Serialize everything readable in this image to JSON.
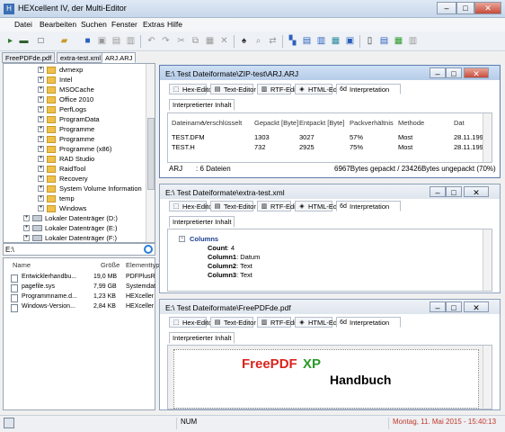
{
  "app": {
    "title": "HEXcellent IV, der Multi-Editor",
    "minimize": "–",
    "maximize": "□",
    "close": "✕"
  },
  "menu": [
    "Datei",
    "Bearbeiten",
    "Suchen",
    "Fenster",
    "Extras",
    "Hilfe"
  ],
  "file_tabs": [
    "FreePDFde.pdf",
    "extra-test.xml",
    "ARJ.ARJ"
  ],
  "tree": [
    {
      "label": "dvmexp",
      "kind": "folder"
    },
    {
      "label": "Intel",
      "kind": "folder"
    },
    {
      "label": "MSOCache",
      "kind": "folder"
    },
    {
      "label": "Office 2010",
      "kind": "folder"
    },
    {
      "label": "PerfLogs",
      "kind": "folder"
    },
    {
      "label": "ProgramData",
      "kind": "folder"
    },
    {
      "label": "Programme",
      "kind": "folder"
    },
    {
      "label": "Programme",
      "kind": "folder"
    },
    {
      "label": "Programme (x86)",
      "kind": "folder"
    },
    {
      "label": "RAD Studio",
      "kind": "folder"
    },
    {
      "label": "RaidTool",
      "kind": "folder"
    },
    {
      "label": "Recovery",
      "kind": "folder"
    },
    {
      "label": "System Volume Information",
      "kind": "folder"
    },
    {
      "label": "temp",
      "kind": "folder"
    },
    {
      "label": "Windows",
      "kind": "folder"
    },
    {
      "label": "Lokaler Datenträger (D:)",
      "kind": "drive"
    },
    {
      "label": "Lokaler Datenträger (E:)",
      "kind": "drive"
    },
    {
      "label": "Lokaler Datenträger (F:)",
      "kind": "drive"
    }
  ],
  "path": "E:\\",
  "filelist": {
    "headers": [
      "Name",
      "Größe",
      "Elementtyp"
    ],
    "rows": [
      {
        "name": "Entwicklerhandbu...",
        "size": "19,0 MB",
        "type": "PDFPlusR"
      },
      {
        "name": "pagefile.sys",
        "size": "7,99 GB",
        "type": "Systemdat"
      },
      {
        "name": "Programmname.d...",
        "size": "1,23 KB",
        "type": "HEXceller"
      },
      {
        "name": "Windows-Version...",
        "size": "2,84 KB",
        "type": "HEXceller"
      }
    ]
  },
  "subtabs": [
    "Hex-Editor",
    "Text-Editor",
    "RTF-Editor",
    "HTML-Editor",
    "Interpretation"
  ],
  "inner_tab": "Interpretierter Inhalt",
  "win1": {
    "title": "E:\\ Test Dateiformate\\ZIP-test\\ARJ.ARJ",
    "headers": [
      "Dateiname",
      "Verschlüsselt",
      "Gepackt [Byte]",
      "Entpackt [Byte]",
      "Packverhältnis",
      "Methode",
      "Dat"
    ],
    "rows": [
      [
        "TEST.DFM",
        "",
        "1303",
        "3027",
        "57%",
        "Most",
        "28.11.1999"
      ],
      [
        "TEST.H",
        "",
        "732",
        "2925",
        "75%",
        "Most",
        "28.11.1999"
      ]
    ],
    "status_left": "ARJ",
    "status_mid": ": 6 Dateien",
    "status_right": "6967Bytes gepackt / 23426Bytes ungepackt (70%)"
  },
  "win2": {
    "title": "E:\\ Test Dateiformate\\extra-test.xml",
    "lines": [
      {
        "key": "Columns",
        "val": ""
      },
      {
        "key": "Count",
        "val": ": 4"
      },
      {
        "key": "Column1",
        "val": ": Datum"
      },
      {
        "key": "Column2",
        "val": ": Text"
      },
      {
        "key": "Column3",
        "val": ": Text"
      }
    ]
  },
  "win3": {
    "title": "E:\\ Test Dateiformate\\FreePDFde.pdf",
    "doc_title_a": "FreePDF",
    "doc_title_b": "XP",
    "doc_sub": "Handbuch",
    "colors": {
      "red": "#d9251d",
      "green": "#2a9a2a",
      "blue": "#2b5fbf"
    }
  },
  "status": {
    "num": "NUM",
    "datetime": "Montag, 11. Mai 2015 - 15:40:13"
  }
}
